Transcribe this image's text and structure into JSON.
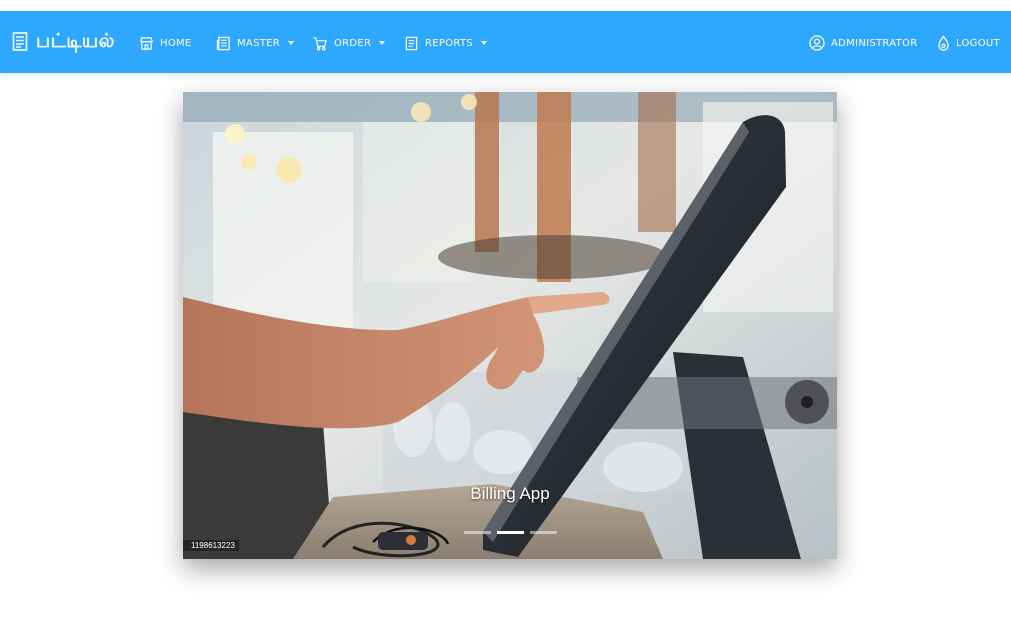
{
  "navbar": {
    "brand": "பட்டியல்",
    "items": [
      {
        "label": "HOME",
        "icon": "store-icon",
        "dropdown": false
      },
      {
        "label": "MASTER",
        "icon": "newspaper-icon",
        "dropdown": true
      },
      {
        "label": "ORDER",
        "icon": "cart-icon",
        "dropdown": true
      },
      {
        "label": "REPORTS",
        "icon": "document-icon",
        "dropdown": true
      }
    ],
    "user": {
      "label": "ADMINISTRATOR",
      "icon": "user-circle-icon"
    },
    "logout": {
      "label": "LOGOUT",
      "icon": "logout-icon"
    },
    "color": "#2ea7ff"
  },
  "carousel": {
    "caption": "Billing App",
    "active_slide": 2,
    "slide_count": 3,
    "image_id_text": "1198613223"
  }
}
